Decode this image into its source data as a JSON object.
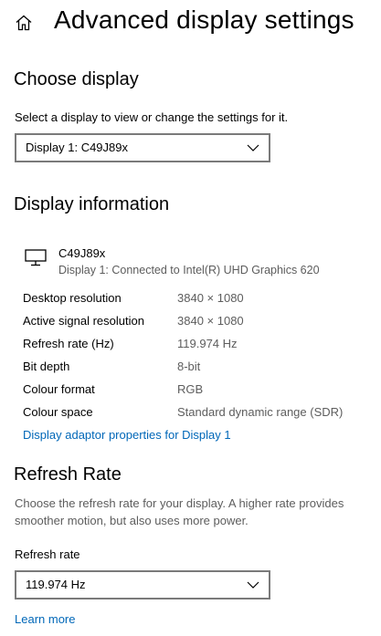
{
  "header": {
    "title": "Advanced display settings"
  },
  "choose_display": {
    "title": "Choose display",
    "description": "Select a display to view or change the settings for it.",
    "selected": "Display 1: C49J89x"
  },
  "display_info": {
    "title": "Display information",
    "monitor_name": "C49J89x",
    "monitor_connection": "Display 1: Connected to Intel(R) UHD Graphics 620",
    "rows": [
      {
        "key": "Desktop resolution",
        "value": "3840 × 1080"
      },
      {
        "key": "Active signal resolution",
        "value": "3840 × 1080"
      },
      {
        "key": "Refresh rate (Hz)",
        "value": "119.974 Hz"
      },
      {
        "key": "Bit depth",
        "value": "8-bit"
      },
      {
        "key": "Colour format",
        "value": "RGB"
      },
      {
        "key": "Colour space",
        "value": "Standard dynamic range (SDR)"
      }
    ],
    "adaptor_link": "Display adaptor properties for Display 1"
  },
  "refresh_rate": {
    "title": "Refresh Rate",
    "description": "Choose the refresh rate for your display. A higher rate provides smoother motion, but also uses more power.",
    "label": "Refresh rate",
    "selected": "119.974 Hz",
    "learn_more": "Learn more"
  },
  "icons": {
    "home": "home-icon",
    "chevron": "chevron-down-icon",
    "monitor": "monitor-icon"
  },
  "colors": {
    "link": "#0067b8",
    "muted_text": "#5d5d5d",
    "dropdown_border": "#7a7a7a"
  }
}
